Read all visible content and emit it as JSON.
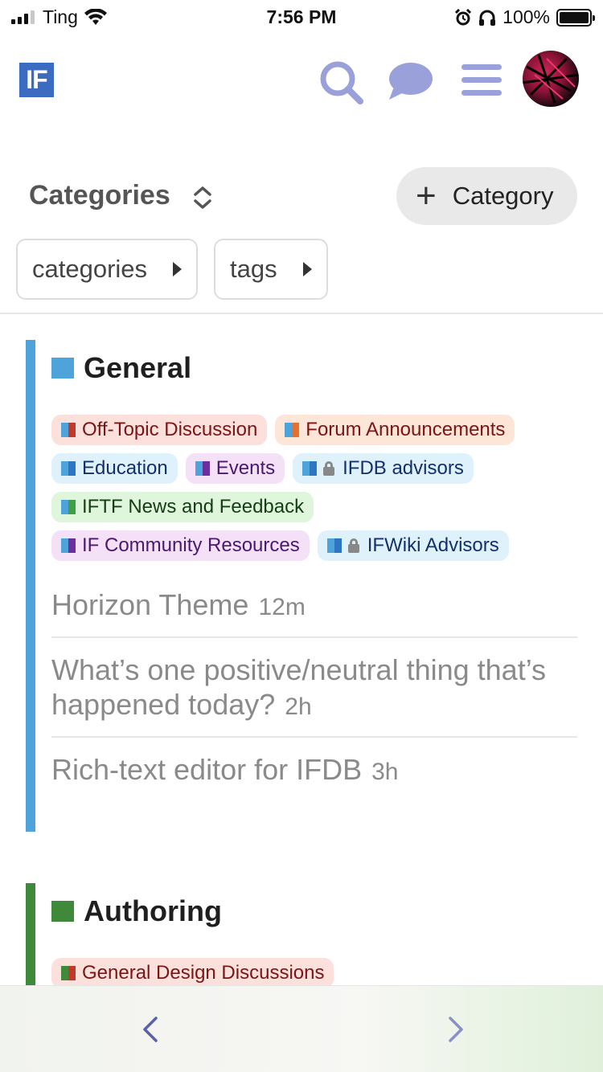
{
  "status": {
    "carrier": "Ting",
    "time": "7:56 PM",
    "battery": "100%"
  },
  "header": {
    "logo": "IF",
    "icons": [
      "search-icon",
      "chat-icon",
      "menu-icon",
      "avatar"
    ],
    "accent": "#9aa0da"
  },
  "page": {
    "title": "Categories",
    "add_button": "Category",
    "filters": [
      "categories",
      "tags"
    ]
  },
  "categories": [
    {
      "name": "General",
      "color": "#4fa3db",
      "subcategories": [
        [
          {
            "label": "Off-Topic Discussion",
            "bg": "#fbe0db",
            "text": "#7a1515",
            "swatch": [
              "#4fa3db",
              "#c0392b"
            ],
            "locked": false
          },
          {
            "label": "Forum Announcements",
            "bg": "#fde5d7",
            "text": "#7a1515",
            "swatch": [
              "#4fa3db",
              "#e8702f"
            ],
            "locked": false
          }
        ],
        [
          {
            "label": "Education",
            "bg": "#dff2fb",
            "text": "#13306b",
            "swatch": [
              "#4fa3db",
              "#2e76c4"
            ],
            "locked": false
          },
          {
            "label": "Events",
            "bg": "#f4e1f7",
            "text": "#4a186e",
            "swatch": [
              "#4fa3db",
              "#6a2e9e"
            ],
            "locked": false
          },
          {
            "label": "IFDB advisors",
            "bg": "#dff2fb",
            "text": "#13306b",
            "swatch": [
              "#4fa3db",
              "#2e76c4"
            ],
            "locked": true
          }
        ],
        [
          {
            "label": "IFTF News and Feedback",
            "bg": "#dff5dc",
            "text": "#143d14",
            "swatch": [
              "#4fa3db",
              "#3e9f44"
            ],
            "locked": false
          }
        ],
        [
          {
            "label": "IF Community Resources",
            "bg": "#f4e1f7",
            "text": "#4a186e",
            "swatch": [
              "#4fa3db",
              "#6a2e9e"
            ],
            "locked": false
          },
          {
            "label": "IFWiki Advisors",
            "bg": "#dff2fb",
            "text": "#13306b",
            "swatch": [
              "#4fa3db",
              "#2e76c4"
            ],
            "locked": true
          }
        ]
      ],
      "topics": [
        {
          "title": "Horizon Theme",
          "age": "12m"
        },
        {
          "title": "What’s one positive/neutral thing that’s happened today?",
          "age": "2h"
        },
        {
          "title": "Rich-text editor for IFDB",
          "age": "3h"
        }
      ]
    },
    {
      "name": "Authoring",
      "color": "#3f8a3a",
      "subcategories": [
        [
          {
            "label": "General Design Discussions",
            "bg": "#fbe0db",
            "text": "#7a1515",
            "swatch": [
              "#3f8a3a",
              "#c0392b"
            ],
            "locked": false
          }
        ]
      ],
      "topics": []
    }
  ]
}
